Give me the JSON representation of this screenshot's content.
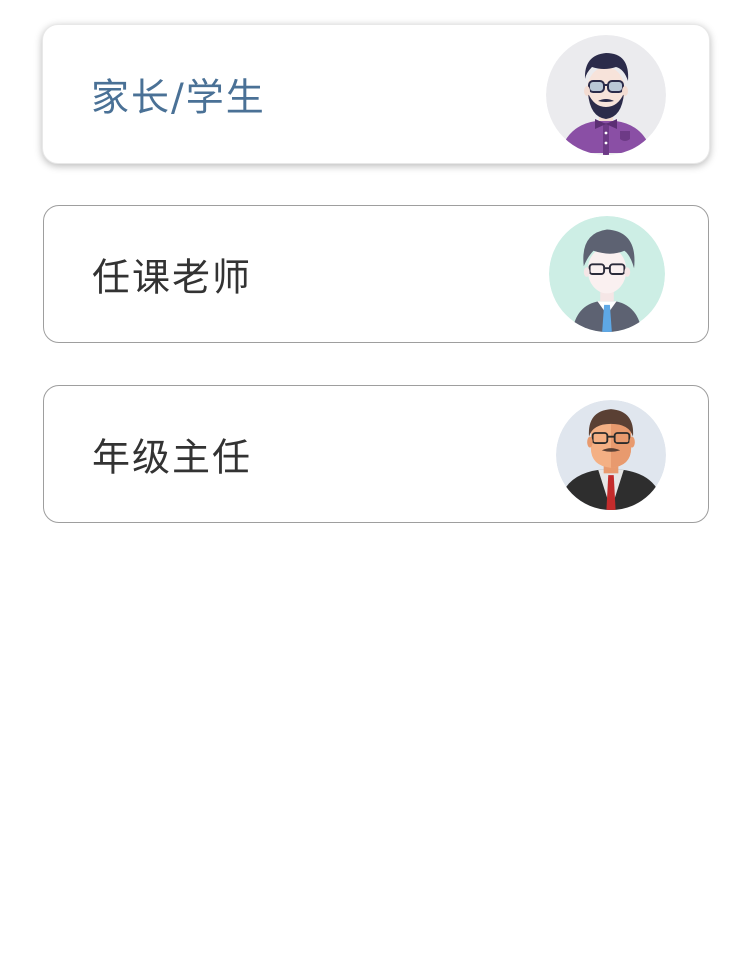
{
  "roles": [
    {
      "label": "家长/学生",
      "avatar_icon": "parent-student-avatar-icon",
      "selected": true,
      "accent_color": "#4a7196",
      "avatar_bg": "#ebebee"
    },
    {
      "label": "任课老师",
      "avatar_icon": "subject-teacher-avatar-icon",
      "selected": false,
      "avatar_bg": "#cdeee5"
    },
    {
      "label": "年级主任",
      "avatar_icon": "grade-director-avatar-icon",
      "selected": false,
      "avatar_bg": "#e0e6ee"
    }
  ]
}
